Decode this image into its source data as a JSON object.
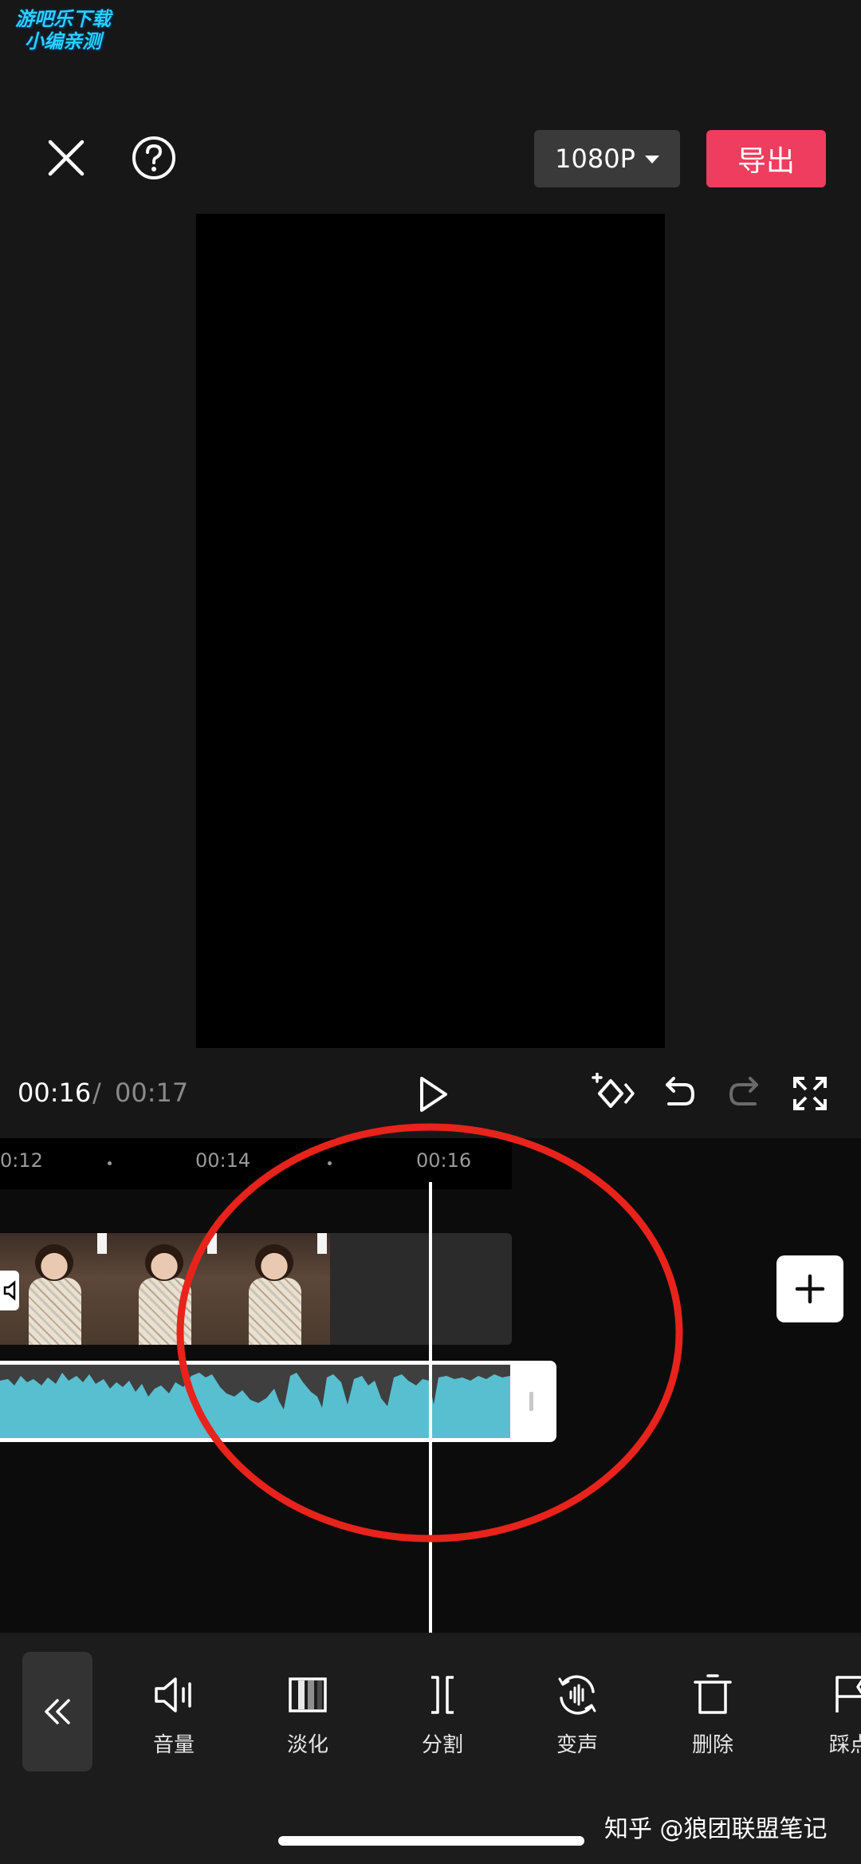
{
  "watermark_top": {
    "line1": "游吧乐下载",
    "line2": "小编亲测"
  },
  "topbar": {
    "close_icon": "close-icon",
    "help_icon": "help-icon",
    "resolution": "1080P",
    "export_label": "导出"
  },
  "playback": {
    "current_time": "00:16",
    "separator": "/",
    "total_time": "00:17",
    "icons": [
      "play-icon",
      "keyframe-icon",
      "undo-icon",
      "redo-icon",
      "fullscreen-icon"
    ]
  },
  "timeline": {
    "ruler_labels": [
      "0:12",
      "00:14",
      "00:16"
    ],
    "clip_frames": 3
  },
  "toolbar": {
    "items": [
      {
        "label": "音量",
        "icon": "volume-icon"
      },
      {
        "label": "淡化",
        "icon": "fade-icon"
      },
      {
        "label": "分割",
        "icon": "split-icon"
      },
      {
        "label": "变声",
        "icon": "voice-change-icon"
      },
      {
        "label": "删除",
        "icon": "delete-icon"
      },
      {
        "label": "踩点",
        "icon": "beat-icon"
      }
    ]
  },
  "watermark_bottom": "知乎 @狼团联盟笔记",
  "colors": {
    "export": "#ee3d5e",
    "waveform": "#58bfd0",
    "annotation": "#e8231b"
  }
}
